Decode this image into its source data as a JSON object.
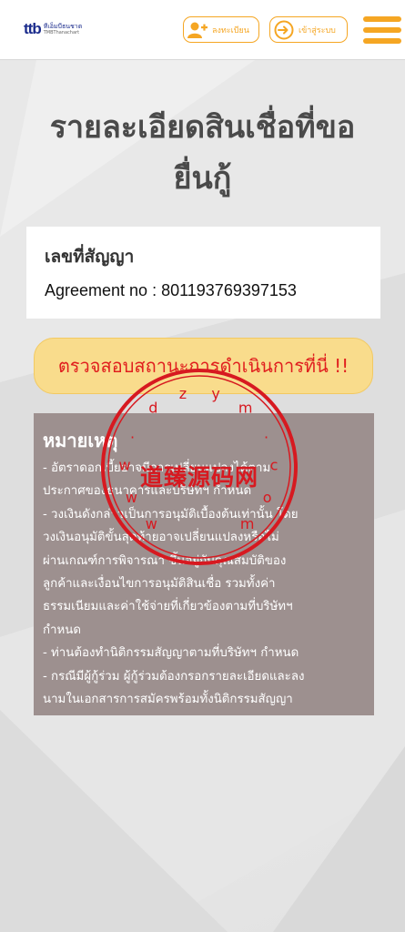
{
  "header": {
    "logo_mark": "ttb",
    "logo_line1": "ทีเอ็มบีธนชาต",
    "logo_line2": "TMBThanachart",
    "register_label": "ลงทะเบียน",
    "login_label": "เข้าสู่ระบบ",
    "icons": {
      "register": "add-user-icon",
      "login": "login-arrow-icon",
      "menu": "hamburger-menu-icon"
    },
    "accent_color": "#f5a623"
  },
  "page": {
    "title_line1": "รายละเอียดสินเชื่อที่ขอ",
    "title_line2": "ยื่นกู้"
  },
  "contract": {
    "label": "เลขที่สัญญา",
    "value": "Agreement no : 801193769397153"
  },
  "status_button": {
    "label": "ตรวจสอบสถานะการดำเนินการที่นี่ !!",
    "color": "#e01e1e"
  },
  "notes": {
    "heading": "หมายเหตุ",
    "lines": [
      "- อัตราดอกเบี้ยอาจมีการเปลี่ยนแปลงได้ตาม",
      "ประกาศของธนาคารและบริษัทฯ กำหนด",
      "- วงเงินดังกล่าวเป็นการอนุมัติเบื้องต้นเท่านั้น โดย",
      "วงเงินอนุมัติขั้นสุดท้ายอาจเปลี่ยนแปลงหรือไม่",
      "ผ่านเกณฑ์การพิจารณา ขึ้นอยู่กับคุณสมบัติของ",
      "ลูกค้าและเงื่อนไขการอนุมัติสินเชื่อ รวมทั้งค่า",
      "ธรรมเนียมและค่าใช้จ่ายที่เกี่ยวข้องตามที่บริษัทฯ",
      "กำหนด",
      "- ท่านต้องทำนิติกรรมสัญญาตามที่บริษัทฯ กำหนด",
      "- กรณีมีผู้กู้ร่วม ผู้กู้ร่วมต้องกรอกรายละเอียดและลง",
      "นามในเอกสารการสมัครพร้อมทั้งนิติกรรมสัญญา"
    ]
  },
  "watermark": {
    "main_text": "道臻源码网",
    "ring_text": "www.dzym.com"
  }
}
